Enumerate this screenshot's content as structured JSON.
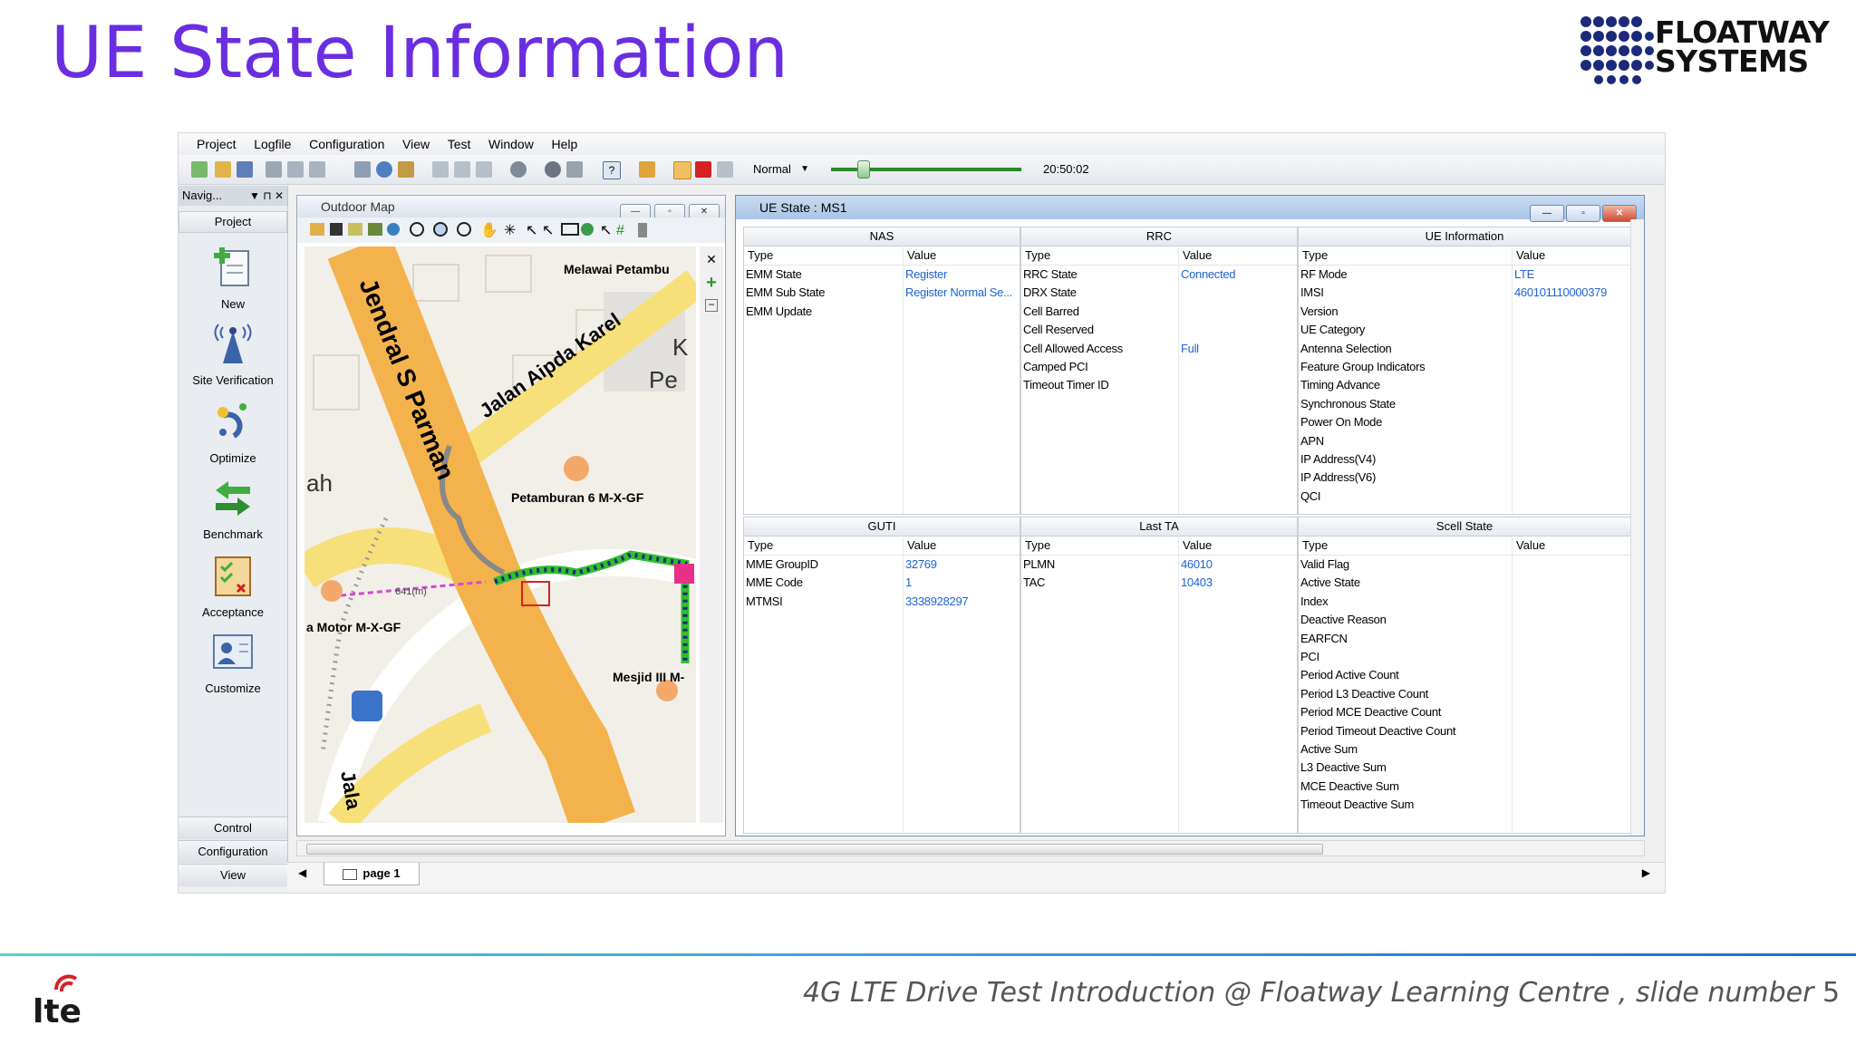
{
  "slide": {
    "title": "UE State Information",
    "footer_text": "4G LTE Drive Test Introduction @ Floatway Learning Centre , slide number",
    "slide_number": "5",
    "logo_text_line1": "FLOATWAY",
    "logo_text_line2": "SYSTEMS",
    "lte_logo_text": "lte"
  },
  "app": {
    "menu": [
      "Project",
      "Logfile",
      "Configuration",
      "View",
      "Test",
      "Window",
      "Help"
    ],
    "toolbar": {
      "mode": "Normal",
      "time": "20:50:02",
      "playback_position": 0.17
    },
    "navigator": {
      "title": "Navig...",
      "project_label": "Project",
      "items": [
        {
          "label": "New",
          "icon": "new-document-icon"
        },
        {
          "label": "Site Verification",
          "icon": "antenna-tower-icon"
        },
        {
          "label": "Optimize",
          "icon": "optimize-icon"
        },
        {
          "label": "Benchmark",
          "icon": "benchmark-arrows-icon"
        },
        {
          "label": "Acceptance",
          "icon": "acceptance-checklist-icon"
        },
        {
          "label": "Customize",
          "icon": "customize-user-icon"
        }
      ],
      "bottom": [
        "Control",
        "Configuration",
        "View"
      ]
    },
    "outdoor_map": {
      "title": "Outdoor Map",
      "labels": [
        "Melawai Petambu",
        "Jendral S Parman",
        "Jalan Aipda Karel",
        "K",
        "Pe",
        "ah",
        "Petamburan 6 M-X-GF",
        "a Motor M-X-GF",
        "Mesjid III M-",
        "Jala",
        "641(m)"
      ]
    },
    "ue_state": {
      "title": "UE State : MS1",
      "col_type": "Type",
      "col_value": "Value",
      "panels": {
        "nas": {
          "title": "NAS",
          "rows": [
            {
              "type": "EMM State",
              "value": "Register"
            },
            {
              "type": "EMM Sub State",
              "value": "Register Normal Se..."
            },
            {
              "type": "EMM Update",
              "value": ""
            }
          ]
        },
        "rrc": {
          "title": "RRC",
          "rows": [
            {
              "type": "RRC State",
              "value": "Connected"
            },
            {
              "type": "DRX State",
              "value": ""
            },
            {
              "type": "Cell Barred",
              "value": ""
            },
            {
              "type": "Cell Reserved",
              "value": ""
            },
            {
              "type": "Cell Allowed Access",
              "value": "Full"
            },
            {
              "type": "Camped PCI",
              "value": ""
            },
            {
              "type": "Timeout Timer ID",
              "value": ""
            }
          ]
        },
        "ue_info": {
          "title": "UE Information",
          "rows": [
            {
              "type": "RF Mode",
              "value": "LTE"
            },
            {
              "type": "IMSI",
              "value": "460101110000379"
            },
            {
              "type": "Version",
              "value": ""
            },
            {
              "type": "UE Category",
              "value": ""
            },
            {
              "type": "Antenna Selection",
              "value": ""
            },
            {
              "type": "Feature Group Indicators",
              "value": ""
            },
            {
              "type": "Timing Advance",
              "value": ""
            },
            {
              "type": "Synchronous State",
              "value": ""
            },
            {
              "type": "Power On Mode",
              "value": ""
            },
            {
              "type": "APN",
              "value": ""
            },
            {
              "type": "IP Address(V4)",
              "value": ""
            },
            {
              "type": "IP Address(V6)",
              "value": ""
            },
            {
              "type": "QCI",
              "value": ""
            }
          ]
        },
        "guti": {
          "title": "GUTI",
          "rows": [
            {
              "type": "MME GroupID",
              "value": "32769"
            },
            {
              "type": "MME Code",
              "value": "1"
            },
            {
              "type": "MTMSI",
              "value": "3338928297"
            }
          ]
        },
        "last_ta": {
          "title": "Last TA",
          "rows": [
            {
              "type": "PLMN",
              "value": "46010"
            },
            {
              "type": "TAC",
              "value": "10403"
            }
          ]
        },
        "scell": {
          "title": "Scell State",
          "rows": [
            {
              "type": "Valid Flag",
              "value": ""
            },
            {
              "type": "Active State",
              "value": ""
            },
            {
              "type": "Index",
              "value": ""
            },
            {
              "type": "Deactive Reason",
              "value": ""
            },
            {
              "type": "EARFCN",
              "value": ""
            },
            {
              "type": "PCI",
              "value": ""
            },
            {
              "type": "Period Active Count",
              "value": ""
            },
            {
              "type": "Period L3 Deactive Count",
              "value": ""
            },
            {
              "type": "Period MCE Deactive Count",
              "value": ""
            },
            {
              "type": "Period Timeout Deactive Count",
              "value": ""
            },
            {
              "type": "Active Sum",
              "value": ""
            },
            {
              "type": "L3 Deactive Sum",
              "value": ""
            },
            {
              "type": "MCE Deactive Sum",
              "value": ""
            },
            {
              "type": "Timeout Deactive Sum",
              "value": ""
            }
          ]
        }
      }
    },
    "page_tab": "page 1",
    "colors": {
      "title": "#6a2ee0",
      "value_text": "#1f63d6",
      "route_green": "#2fbf2f",
      "road_yellow": "#f7e07a",
      "road_orange": "#f4b24d"
    }
  }
}
